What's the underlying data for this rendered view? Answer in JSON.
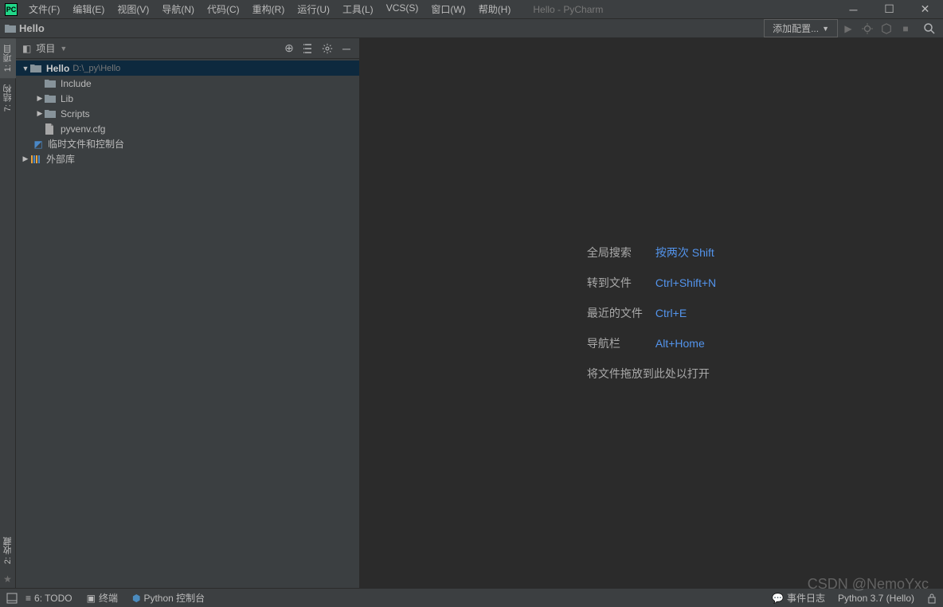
{
  "app": {
    "title": "Hello - PyCharm",
    "icon_text": "PC"
  },
  "menu": {
    "file": "文件(F)",
    "edit": "编辑(E)",
    "view": "视图(V)",
    "navigate": "导航(N)",
    "code": "代码(C)",
    "refactor": "重构(R)",
    "run": "运行(U)",
    "tools": "工具(L)",
    "vcs": "VCS(S)",
    "window": "窗口(W)",
    "help": "帮助(H)"
  },
  "navbar": {
    "project_name": "Hello",
    "config_label": "添加配置..."
  },
  "left_tabs": {
    "project": "1: 项目",
    "structure": "7: 结构",
    "favorites": "2: 收藏"
  },
  "panel": {
    "title": "项目",
    "tree": {
      "root": {
        "name": "Hello",
        "path": "D:\\_py\\Hello"
      },
      "include": "Include",
      "lib": "Lib",
      "scripts": "Scripts",
      "pyvenv": "pyvenv.cfg",
      "scratches": "临时文件和控制台",
      "external": "外部库"
    }
  },
  "tips": {
    "search_label": "全局搜索",
    "search_key": "按两次 Shift",
    "goto_label": "转到文件",
    "goto_key": "Ctrl+Shift+N",
    "recent_label": "最近的文件",
    "recent_key": "Ctrl+E",
    "nav_label": "导航栏",
    "nav_key": "Alt+Home",
    "drop": "将文件拖放到此处以打开"
  },
  "status": {
    "todo": "6: TODO",
    "terminal": "终端",
    "console": "Python 控制台",
    "event_log": "事件日志",
    "interpreter": "Python 3.7 (Hello)"
  },
  "watermark": "CSDN @NemoYxc"
}
